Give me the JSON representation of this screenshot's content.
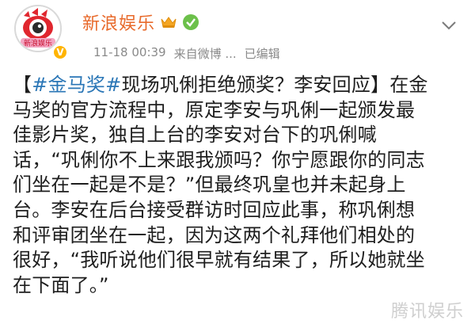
{
  "account": {
    "name": "新浪娱乐",
    "avatar_label": "新浪娱乐",
    "vip_label": "V"
  },
  "meta": {
    "time": "11-18 00:39",
    "source": "来自微博 ...",
    "edited": "已编辑"
  },
  "post": {
    "lines": [
      [
        "【",
        "#金马奖#",
        "现场巩俐拒绝颁奖？李安回应】在金"
      ],
      [
        "马奖的官方流程中，原定李安与巩俐一起颁发最"
      ],
      [
        "佳影片奖，独自上台的李安对台下的巩俐喊"
      ],
      [
        "话，“巩俐你不上来跟我颁吗？你宁愿跟你的同志"
      ],
      [
        "们坐在一起是不是？”但最终巩皇也并未起身上"
      ],
      [
        "台。李安在后台接受群访时回应此事，称巩俐想"
      ],
      [
        "和评审团坐在一起，因为这两个礼拜他们相处的"
      ],
      [
        "很好，“我听说他们很早就有结果了，所以她就坐"
      ],
      [
        "在下面了。”"
      ]
    ]
  },
  "watermark": "腾讯娱乐",
  "colors": {
    "name": "#e86a2b",
    "tag": "#2a76b6",
    "meta": "#8a8a8a",
    "text": "#1e1e1e"
  }
}
